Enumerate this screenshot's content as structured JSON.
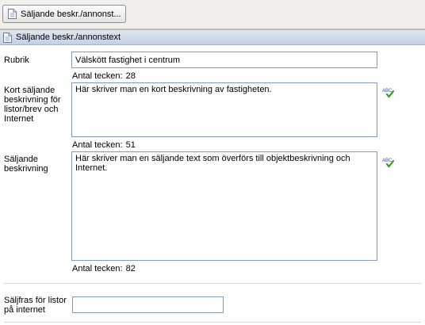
{
  "toolbar": {
    "tab_button_label": "Säljande beskr./annonst..."
  },
  "section": {
    "title": "Säljande beskr./annonstext"
  },
  "fields": {
    "rubrik": {
      "label": "Rubrik",
      "value": "Välskött fastighet i centrum",
      "count_label": "Antal tecken:",
      "count": "28"
    },
    "kort": {
      "label": "Kort säljande beskrivning för listor/brev och Internet",
      "value": "Här skriver man en kort beskrivning av fastigheten.",
      "count_label": "Antal tecken:",
      "count": "51"
    },
    "lang": {
      "label": "Säljande beskrivning",
      "value": "Här skriver man en säljande text som överförs till objektbeskrivning och Internet.",
      "count_label": "Antal tecken:",
      "count": "82"
    },
    "saljfras": {
      "label": "Säljfras för listor på internet",
      "value": ""
    }
  },
  "icons": {
    "spellcheck_text": "ABC",
    "spellcheck_check": "✔"
  },
  "colors": {
    "header_bg": "#c4d1e2",
    "field_border": "#7f9db9",
    "check_green": "#3a9a2a"
  }
}
